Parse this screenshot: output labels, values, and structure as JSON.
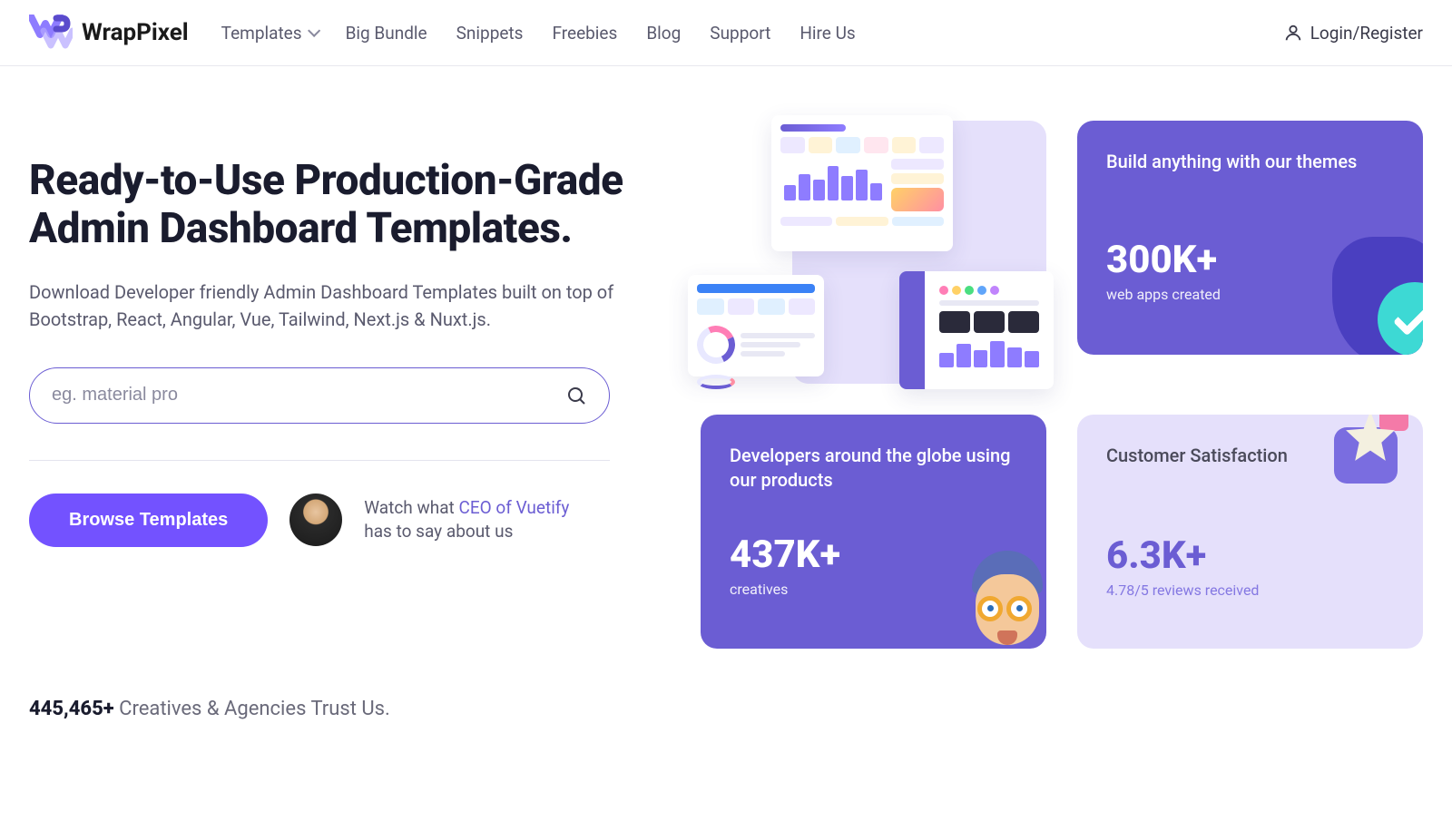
{
  "brand": "WrapPixel",
  "nav": {
    "templates": "Templates",
    "big_bundle": "Big Bundle",
    "snippets": "Snippets",
    "freebies": "Freebies",
    "blog": "Blog",
    "support": "Support",
    "hire_us": "Hire Us"
  },
  "auth": {
    "login_register": "Login/Register"
  },
  "hero": {
    "title": "Ready-to-Use Production-Grade Admin Dashboard Templates.",
    "desc": "Download Developer friendly Admin Dashboard Templates built on top of Bootstrap, React, Angular, Vue, Tailwind, Next.js & Nuxt.js.",
    "search_placeholder": "eg. material pro",
    "browse": "Browse Templates",
    "ceo_prefix": "Watch what ",
    "ceo_link": "CEO of Vuetify",
    "ceo_suffix": " has to say about us"
  },
  "cards": {
    "build": {
      "title": "Build anything with our themes",
      "big": "300K+",
      "sub": "web apps created"
    },
    "dev": {
      "title": "Developers around the globe using our products",
      "big": "437K+",
      "sub": "creatives"
    },
    "sat": {
      "title": "Customer Satisfaction",
      "big": "6.3K+",
      "sub": "4.78/5 reviews received"
    }
  },
  "trust": {
    "count": "445,465+",
    "text": " Creatives & Agencies Trust Us."
  },
  "colors": {
    "accent": "#6b5dd3",
    "accent2": "#7352ff",
    "lilac": "#e5e0fb"
  }
}
